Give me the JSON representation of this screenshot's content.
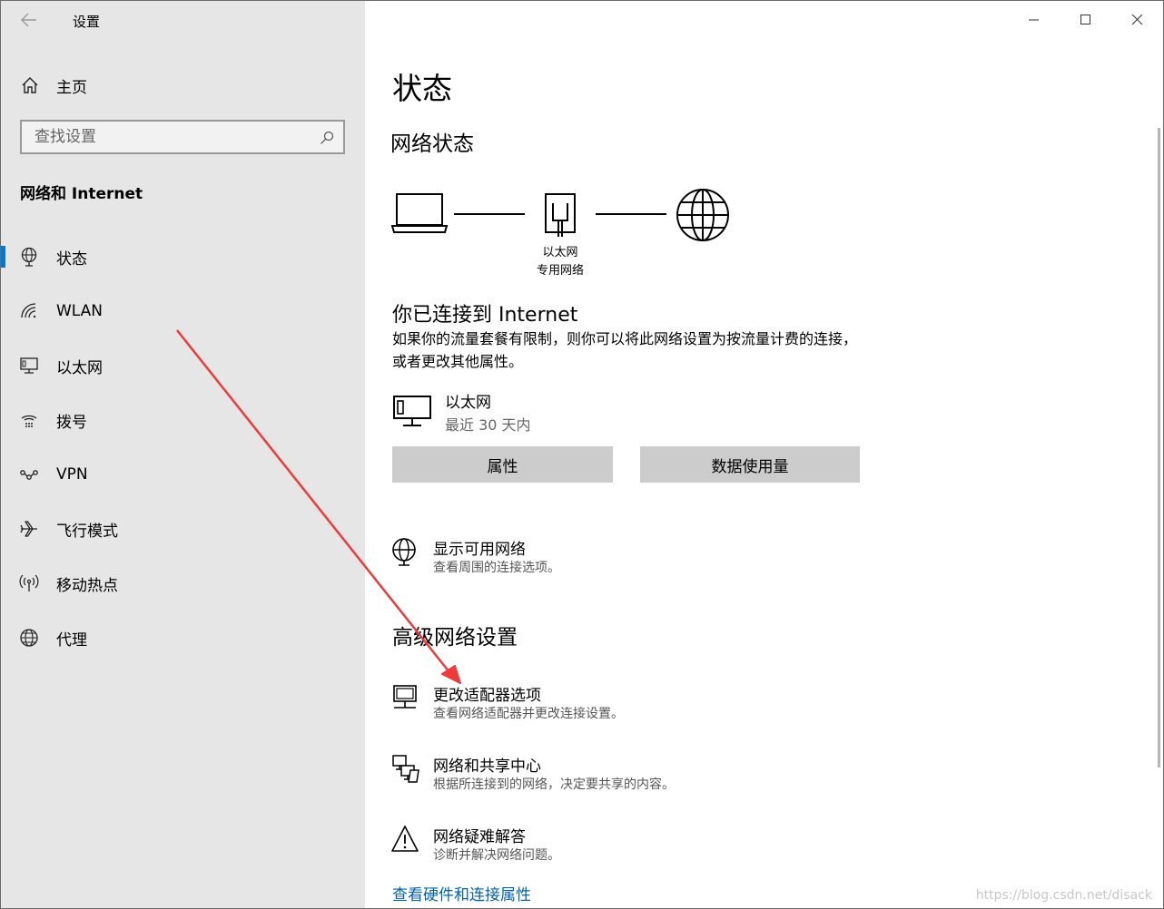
{
  "window": {
    "title": "设置"
  },
  "sidebar": {
    "home_label": "主页",
    "search_placeholder": "查找设置",
    "section_title": "网络和 Internet",
    "items": [
      {
        "label": "状态",
        "icon": "globe-status-icon",
        "active": true
      },
      {
        "label": "WLAN",
        "icon": "wifi-icon"
      },
      {
        "label": "以太网",
        "icon": "ethernet-icon"
      },
      {
        "label": "拨号",
        "icon": "dialup-icon"
      },
      {
        "label": "VPN",
        "icon": "vpn-icon"
      },
      {
        "label": "飞行模式",
        "icon": "airplane-icon"
      },
      {
        "label": "移动热点",
        "icon": "hotspot-icon"
      },
      {
        "label": "代理",
        "icon": "globe-icon"
      }
    ]
  },
  "main": {
    "page_title": "状态",
    "network_status_title": "网络状态",
    "diagram": {
      "adapter_name": "以太网",
      "network_type": "专用网络"
    },
    "connected_title": "你已连接到 Internet",
    "connected_desc": "如果你的流量套餐有限制，则你可以将此网络设置为按流量计费的连接，或者更改其他属性。",
    "connection": {
      "name": "以太网",
      "usage": "最近 30 天内"
    },
    "buttons": {
      "properties": "属性",
      "data_usage": "数据使用量"
    },
    "show_networks": {
      "title": "显示可用网络",
      "desc": "查看周围的连接选项。"
    },
    "advanced_title": "高级网络设置",
    "advanced_items": [
      {
        "title": "更改适配器选项",
        "desc": "查看网络适配器并更改连接设置。"
      },
      {
        "title": "网络和共享中心",
        "desc": "根据所连接到的网络，决定要共享的内容。"
      },
      {
        "title": "网络疑难解答",
        "desc": "诊断并解决网络问题。"
      }
    ],
    "bottom_link": "查看硬件和连接属性"
  },
  "watermark": "https://blog.csdn.net/disack",
  "colors": {
    "sidebar_bg": "#e6e6e6",
    "accent": "#0078d7",
    "link": "#0063b1",
    "button_bg": "#cccccc",
    "annotation_arrow": "#ee3a3a"
  }
}
